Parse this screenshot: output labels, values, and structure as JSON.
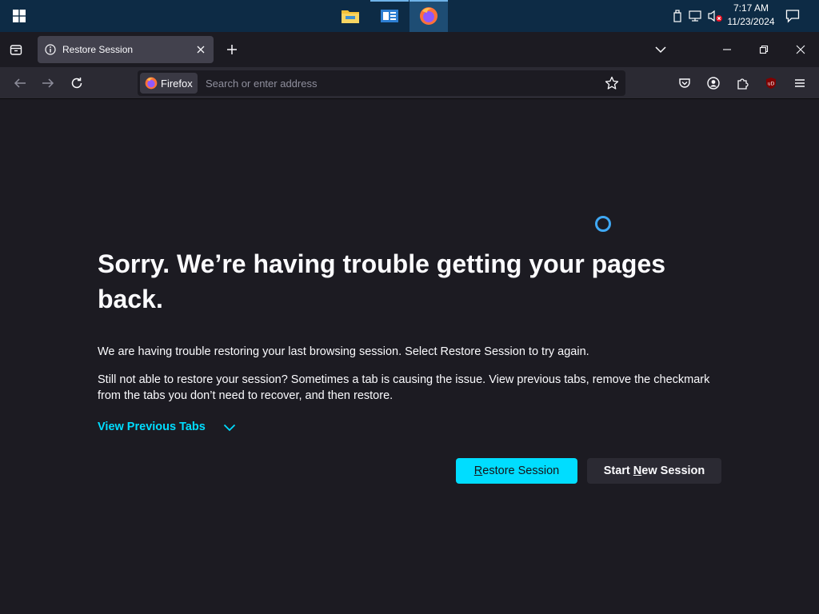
{
  "taskbar": {
    "start_icon": "windows-logo-icon",
    "apps": [
      {
        "name": "file-explorer-icon",
        "active": false
      },
      {
        "name": "news-app-icon",
        "active": false
      },
      {
        "name": "firefox-icon",
        "active": true
      }
    ],
    "clock": {
      "time": "7:17 AM",
      "date": "11/23/2024"
    },
    "colors": {
      "bar": "#0d2b45",
      "active": "#1e4d74"
    }
  },
  "browser": {
    "tab": {
      "title": "Restore Session",
      "icon": "info-icon"
    },
    "identity_label": "Firefox",
    "address_placeholder": "Search or enter address"
  },
  "page": {
    "heading": "Sorry. We’re having trouble getting your pages back.",
    "paragraph1": "We are having trouble restoring your last browsing session. Select Restore Session to try again.",
    "paragraph2": "Still not able to restore your session? Sometimes a tab is causing the issue. View previous tabs, remove the checkmark from the tabs you don’t need to recover, and then restore.",
    "view_previous_tabs": "View Previous Tabs",
    "restore_button": {
      "accel": "R",
      "rest": "estore Session"
    },
    "new_session_button": {
      "before": "Start ",
      "accel": "N",
      "after": "ew Session"
    },
    "colors": {
      "accent": "#00ddff",
      "background": "#1c1b22",
      "text": "#fbfbfe"
    }
  }
}
